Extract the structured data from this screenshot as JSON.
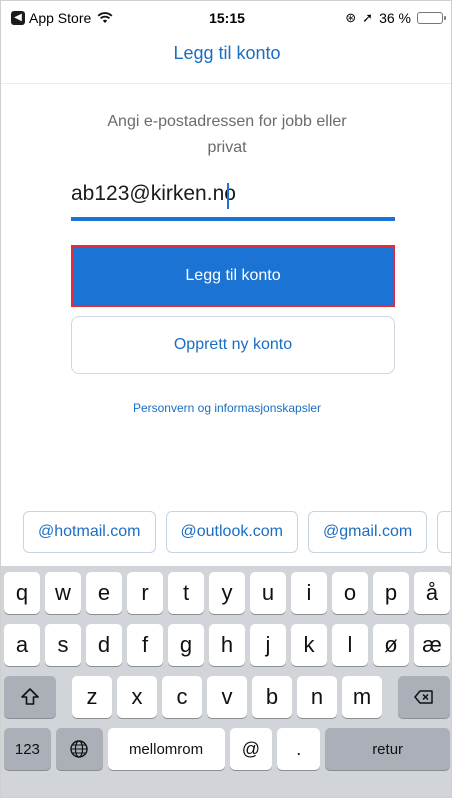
{
  "status_bar": {
    "back_app": "App Store",
    "time": "15:15",
    "battery": "36 %",
    "battery_level": 0.36
  },
  "header": {
    "title": "Legg til konto"
  },
  "main": {
    "prompt": "Angi e-postadressen for jobb eller privat",
    "email_value": "ab123@kirken.no",
    "primary_button": "Legg til konto",
    "secondary_button": "Opprett ny konto",
    "privacy_link": "Personvern og informasjonskapsler"
  },
  "suggestions": [
    "@hotmail.com",
    "@outlook.com",
    "@gmail.com",
    "@"
  ],
  "keyboard": {
    "row1": [
      "q",
      "w",
      "e",
      "r",
      "t",
      "y",
      "u",
      "i",
      "o",
      "p",
      "å"
    ],
    "row2": [
      "a",
      "s",
      "d",
      "f",
      "g",
      "h",
      "j",
      "k",
      "l",
      "ø",
      "æ"
    ],
    "row3": [
      "z",
      "x",
      "c",
      "v",
      "b",
      "n",
      "m"
    ],
    "key_123": "123",
    "space": "mellomrom",
    "at": "@",
    "dot": ".",
    "return": "retur"
  },
  "colors": {
    "accent": "#1b73d4",
    "link": "#1b6ec2",
    "highlight_border": "#e52b3b",
    "keyboard_bg": "#d1d4d9"
  }
}
